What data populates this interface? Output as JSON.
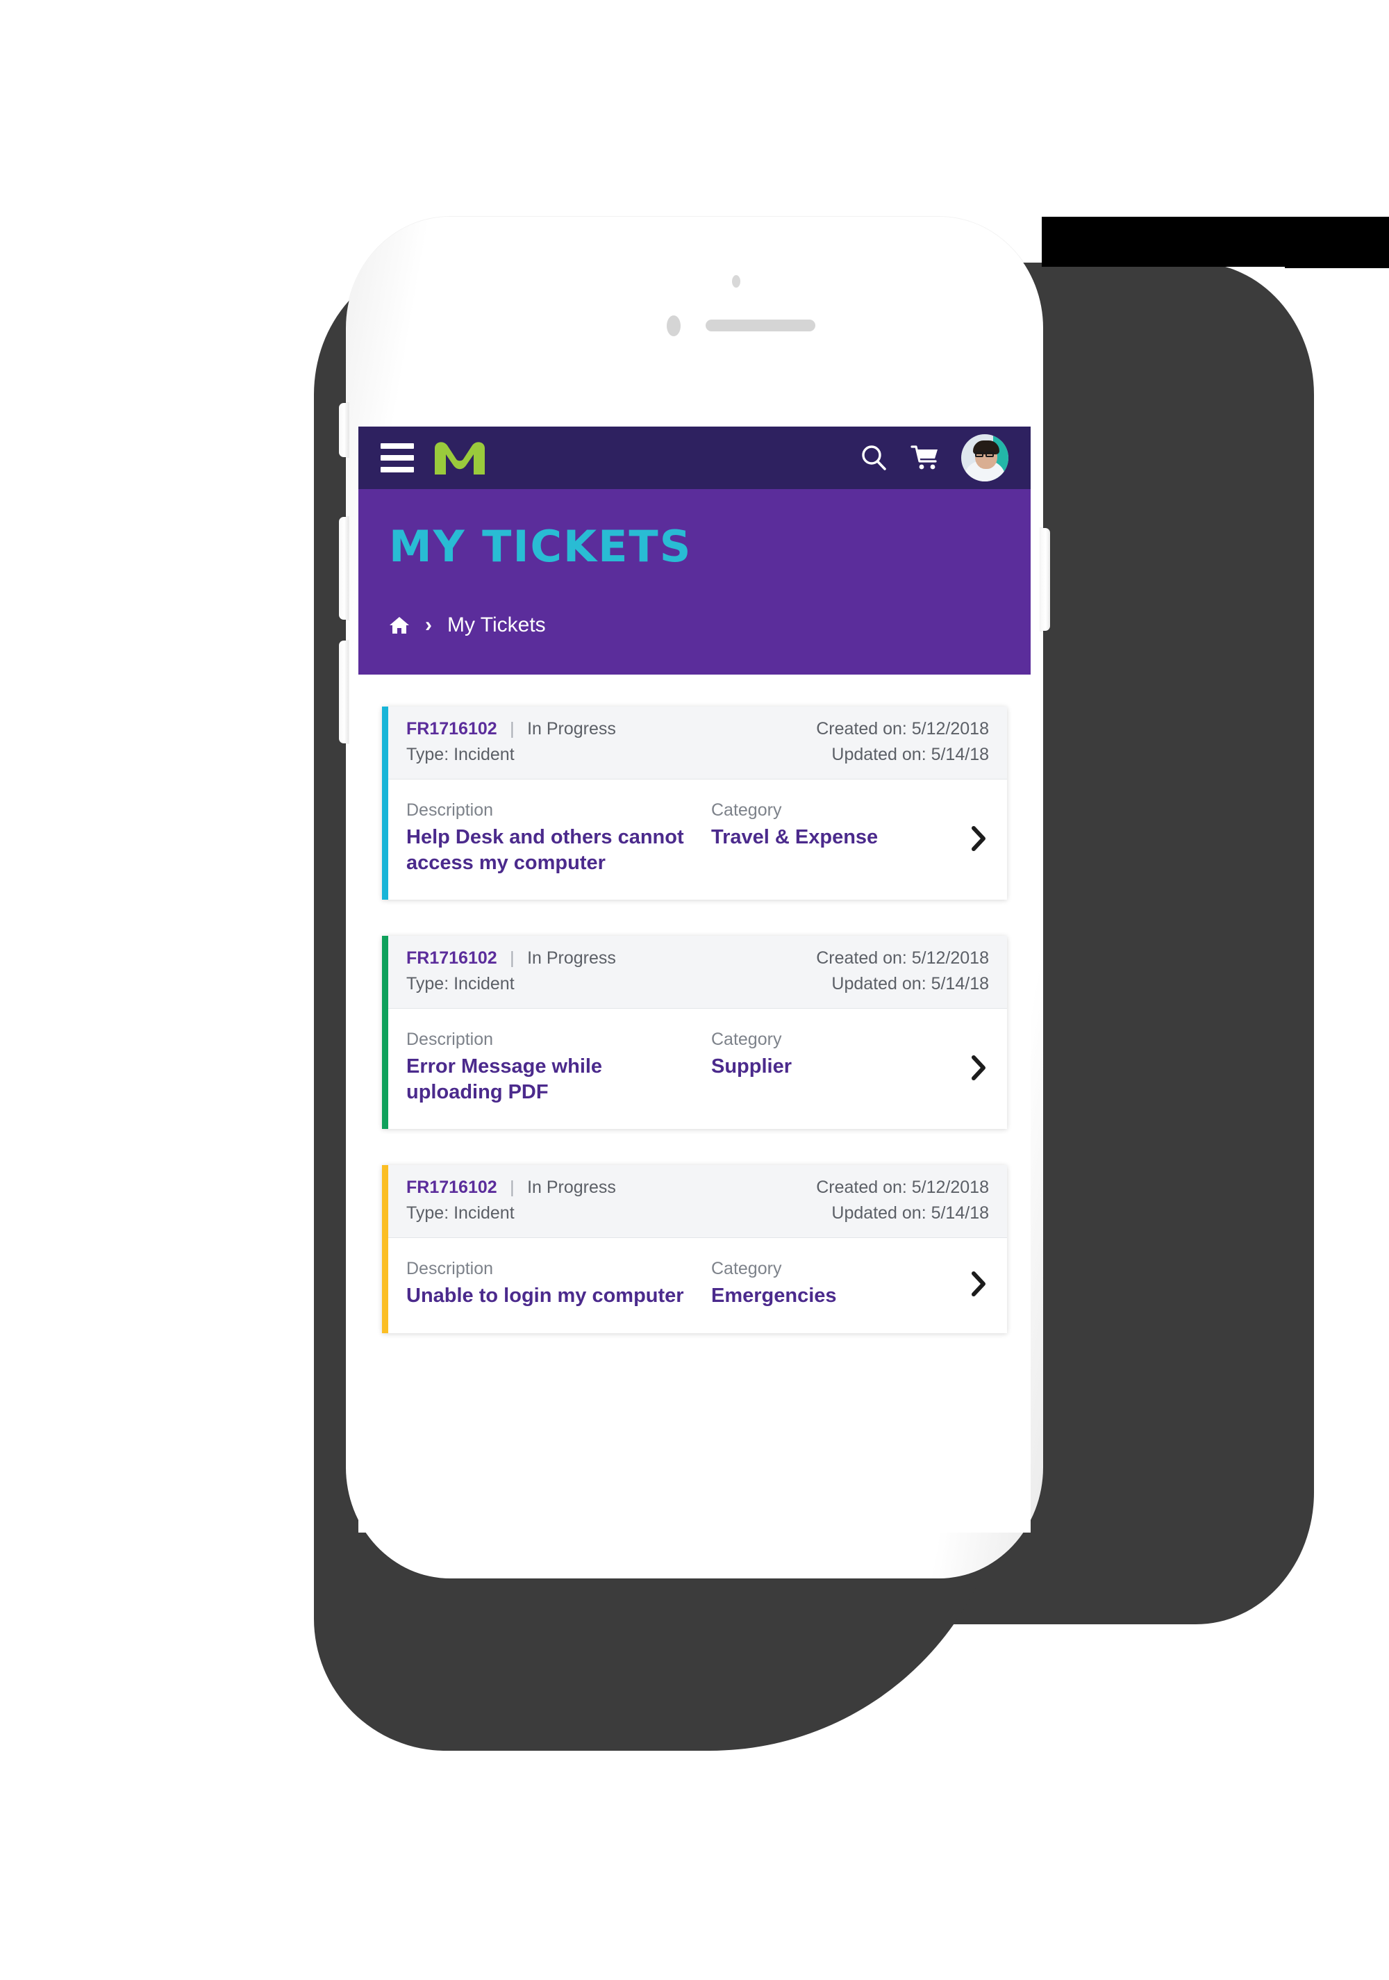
{
  "device": {
    "name": "white-smartphone-mockup",
    "hardware": {
      "silent_switch": "silent-switch",
      "volume_up": "volume-up-button",
      "volume_down": "volume-down-button",
      "power": "power-button",
      "home": "home-button",
      "camera": "front-camera",
      "speaker": "earpiece-speaker",
      "sensor": "proximity-sensor"
    }
  },
  "navbar": {
    "menu_icon": "hamburger-menu-icon",
    "logo": "m-brand-logo",
    "logo_color": "#9ACA3C",
    "background": "#2E2160",
    "actions": [
      {
        "name": "search-icon",
        "label": "Search"
      },
      {
        "name": "cart-icon",
        "label": "Cart"
      },
      {
        "name": "avatar",
        "label": "User profile"
      }
    ]
  },
  "hero": {
    "title": "MY TICKETS",
    "title_color": "#29BCD4",
    "background": "#5B2D9B",
    "breadcrumb": {
      "home_icon": "home-icon",
      "separator": "›",
      "current": "My Tickets"
    }
  },
  "labels": {
    "description": "Description",
    "category": "Category",
    "type_prefix": "Type:",
    "created_prefix": "Created on:",
    "updated_prefix": "Updated on:",
    "id_separator": "|",
    "chevron": "›"
  },
  "tickets": [
    {
      "id": "FR1716102",
      "separator": "|",
      "status": "In Progress",
      "type": "Type: Incident",
      "created": "Created on: 5/12/2018",
      "updated": "Updated on: 5/14/18",
      "description_label": "Description",
      "description": "Help Desk and others cannot access my computer",
      "category_label": "Category",
      "category": "Travel & Expense",
      "accent_color": "#18B5D8"
    },
    {
      "id": "FR1716102",
      "separator": "|",
      "status": "In Progress",
      "type": "Type: Incident",
      "created": "Created on: 5/12/2018",
      "updated": "Updated on: 5/14/18",
      "description_label": "Description",
      "description": "Error Message while uploading PDF",
      "category_label": "Category",
      "category": "Supplier",
      "accent_color": "#0FA15C"
    },
    {
      "id": "FR1716102",
      "separator": "|",
      "status": "In Progress",
      "type": "Type: Incident",
      "created": "Created on: 5/12/2018",
      "updated": "Updated on: 5/14/18",
      "description_label": "Description",
      "description": "Unable to login my computer",
      "category_label": "Category",
      "category": "Emergencies",
      "accent_color": "#FBBE24"
    }
  ],
  "theme": {
    "nav_dark_purple": "#2E2160",
    "hero_purple": "#5B2D9B",
    "teal": "#29BCD4",
    "green_logo": "#9ACA3C",
    "link_purple": "#4B2A8C",
    "muted_text": "#5B5F66",
    "card_head_bg": "#F4F5F7",
    "shadow_gray": "#3C3C3C"
  }
}
